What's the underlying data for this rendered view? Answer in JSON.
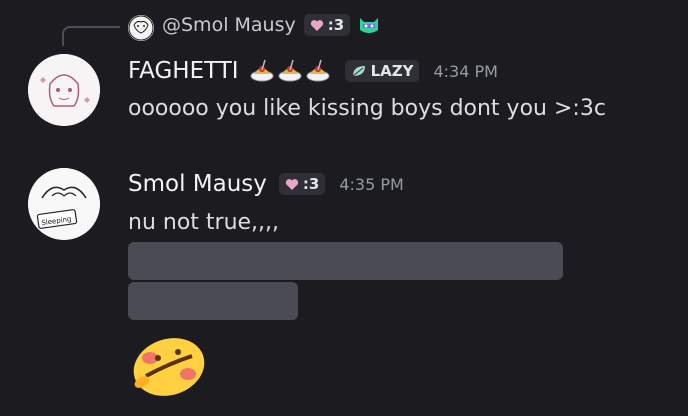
{
  "reply": {
    "author": "@Smol Mausy",
    "role_tag": ":3"
  },
  "messages": [
    {
      "author": "FAGHETTI",
      "role_tag": "LAZY",
      "timestamp": "4:34 PM",
      "text": "oooooo you like kissing boys dont you >:3c"
    },
    {
      "author": "Smol Mausy",
      "role_tag": ":3",
      "timestamp": "4:35 PM",
      "text": "nu not true,,,,",
      "avatar_caption": "Sleeping"
    }
  ],
  "colors": {
    "background": "#1c1c20",
    "redacted_block": "#4b4c53",
    "role_badge_bg": "#2f3036",
    "timestamp": "#949ba4"
  },
  "icons": [
    "reply-avatar-icon",
    "heart-icon",
    "nitro-cat-icon",
    "spaghetti-icon",
    "leaf-icon",
    "flushed-emoji-icon"
  ]
}
